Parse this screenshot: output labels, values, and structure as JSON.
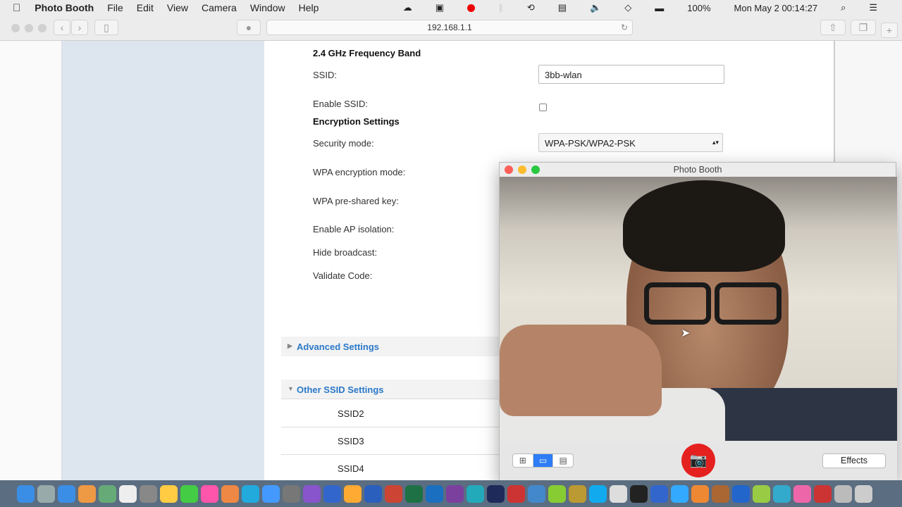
{
  "menubar": {
    "app": "Photo Booth",
    "items": [
      "File",
      "Edit",
      "View",
      "Camera",
      "Window",
      "Help"
    ],
    "battery": "100%",
    "clock": "Mon May 2  00:14:27"
  },
  "browser": {
    "url": "192.168.1.1"
  },
  "form": {
    "band_title": "2.4 GHz Frequency Band",
    "ssid_label": "SSID:",
    "ssid_value": "3bb-wlan",
    "enable_ssid_label": "Enable SSID:",
    "enable_ssid_checked": false,
    "encryption_title": "Encryption Settings",
    "security_mode_label": "Security mode:",
    "security_mode_value": "WPA-PSK/WPA2-PSK",
    "wpa_enc_label": "WPA encryption mode:",
    "wpa_key_label": "WPA pre-shared key:",
    "ap_isolation_label": "Enable AP isolation:",
    "hide_broadcast_label": "Hide broadcast:",
    "validate_label": "Validate Code:"
  },
  "sections": {
    "advanced": "Advanced Settings",
    "other": "Other SSID Settings",
    "ssids": [
      "SSID2",
      "SSID3",
      "SSID4"
    ]
  },
  "photobooth": {
    "title": "Photo Booth",
    "effects": "Effects",
    "view_modes": [
      "grid",
      "single",
      "strip"
    ],
    "selected_view": "single",
    "shutter_color": "#e5211f"
  },
  "dock": {
    "icon_colors": [
      "#3a8ee6",
      "#9aa",
      "#3a8ee6",
      "#e94",
      "#6a7",
      "#eee",
      "#888",
      "#fc4",
      "#4c4",
      "#f5a",
      "#e84",
      "#2ad",
      "#49f",
      "#777",
      "#85c",
      "#36c",
      "#fa3",
      "#2b5fbd",
      "#c43",
      "#1e7145",
      "#1a6fc0",
      "#7b3f9e",
      "#2ab",
      "#1e2b5a",
      "#c33",
      "#48c",
      "#8c3",
      "#b93",
      "#1ae",
      "#ddd",
      "#222",
      "#36c",
      "#3af",
      "#e83",
      "#a63",
      "#26c",
      "#9c4",
      "#3ac",
      "#e6a",
      "#c33",
      "#bbb",
      "#ccc"
    ]
  }
}
